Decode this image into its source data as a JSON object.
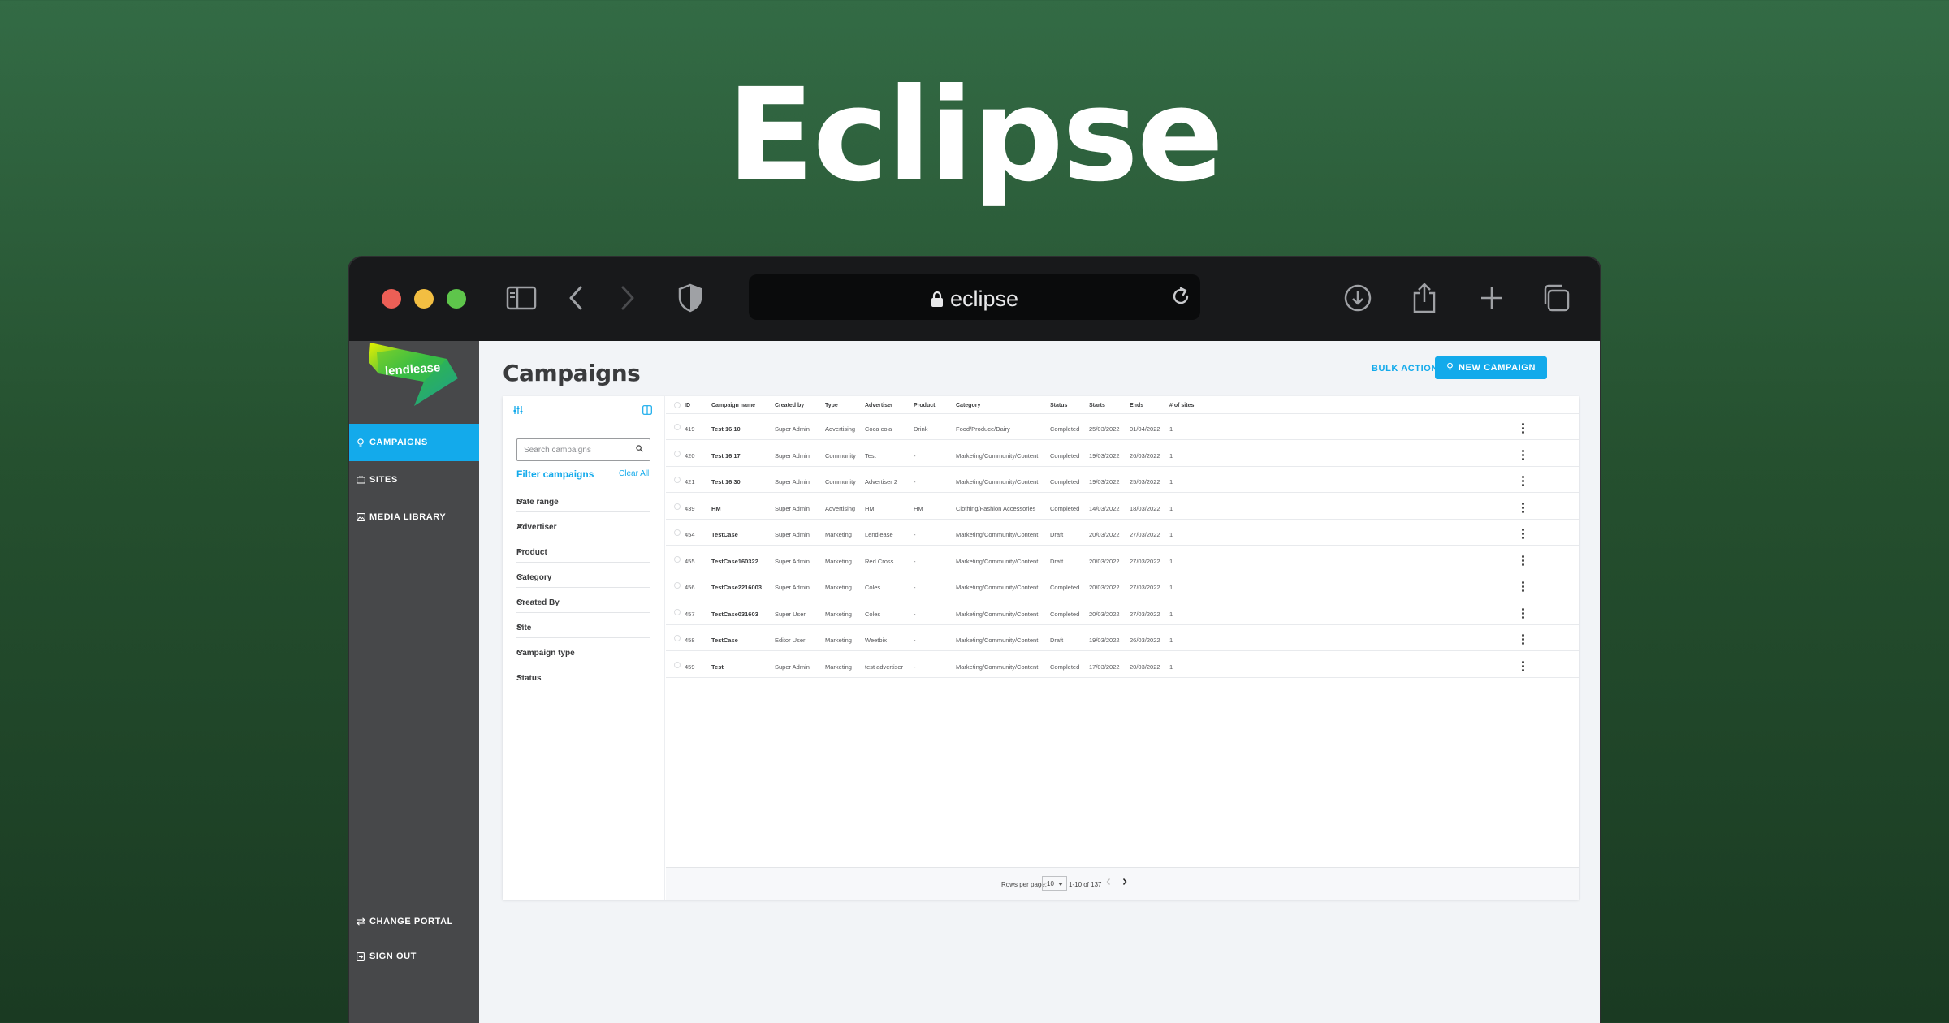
{
  "hero": {
    "title": "Eclipse"
  },
  "browser": {
    "url": "eclipse"
  },
  "sidebar": {
    "logo_text": "lendlease",
    "items": [
      {
        "label": "CAMPAIGNS",
        "icon": "lightbulb-icon",
        "active": true
      },
      {
        "label": "SITES",
        "icon": "tv-icon",
        "active": false
      },
      {
        "label": "MEDIA LIBRARY",
        "icon": "image-icon",
        "active": false
      }
    ],
    "bottom_items": [
      {
        "label": "CHANGE PORTAL",
        "icon": "swap-icon"
      },
      {
        "label": "SIGN OUT",
        "icon": "signout-icon"
      }
    ]
  },
  "page": {
    "title": "Campaigns",
    "bulk_actions": "BULK ACTIONS",
    "new_campaign": "NEW CAMPAIGN"
  },
  "filters": {
    "search_placeholder": "Search campaigns",
    "title": "Filter campaigns",
    "clear_all": "Clear All",
    "items": [
      "Date range",
      "Advertiser",
      "Product",
      "Category",
      "Created By",
      "Site",
      "Campaign type",
      "Status"
    ]
  },
  "table": {
    "columns": [
      "ID",
      "Campaign name",
      "Created by",
      "Type",
      "Advertiser",
      "Product",
      "Category",
      "Status",
      "Starts",
      "Ends",
      "# of sites"
    ],
    "rows": [
      [
        "419",
        "Test 16 10",
        "Super Admin",
        "Advertising",
        "Coca cola",
        "Drink",
        "Food/Produce/Dairy",
        "Completed",
        "25/03/2022",
        "01/04/2022",
        "1"
      ],
      [
        "420",
        "Test 16 17",
        "Super Admin",
        "Community",
        "Test",
        "-",
        "Marketing/Community/Content",
        "Completed",
        "19/03/2022",
        "26/03/2022",
        "1"
      ],
      [
        "421",
        "Test 16 30",
        "Super Admin",
        "Community",
        "Advertiser 2",
        "-",
        "Marketing/Community/Content",
        "Completed",
        "19/03/2022",
        "25/03/2022",
        "1"
      ],
      [
        "439",
        "HM",
        "Super Admin",
        "Advertising",
        "HM",
        "HM",
        "Clothing/Fashion Accessories",
        "Completed",
        "14/03/2022",
        "18/03/2022",
        "1"
      ],
      [
        "454",
        "TestCase",
        "Super Admin",
        "Marketing",
        "Lendlease",
        "-",
        "Marketing/Community/Content",
        "Draft",
        "20/03/2022",
        "27/03/2022",
        "1"
      ],
      [
        "455",
        "TestCase160322",
        "Super Admin",
        "Marketing",
        "Red Cross",
        "-",
        "Marketing/Community/Content",
        "Draft",
        "20/03/2022",
        "27/03/2022",
        "1"
      ],
      [
        "456",
        "TestCase2216003",
        "Super Admin",
        "Marketing",
        "Coles",
        "-",
        "Marketing/Community/Content",
        "Completed",
        "20/03/2022",
        "27/03/2022",
        "1"
      ],
      [
        "457",
        "TestCase031603",
        "Super User",
        "Marketing",
        "Coles",
        "-",
        "Marketing/Community/Content",
        "Completed",
        "20/03/2022",
        "27/03/2022",
        "1"
      ],
      [
        "458",
        "TestCase",
        "Editor User",
        "Marketing",
        "Weetbix",
        "-",
        "Marketing/Community/Content",
        "Draft",
        "19/03/2022",
        "26/03/2022",
        "1"
      ],
      [
        "459",
        "Test",
        "Super Admin",
        "Marketing",
        "test advertiser",
        "-",
        "Marketing/Community/Content",
        "Completed",
        "17/03/2022",
        "20/03/2022",
        "1"
      ]
    ]
  },
  "pagination": {
    "rows_per_page_label": "Rows per page:",
    "rows_per_page": "10",
    "range": "1-10 of 137"
  },
  "colors": {
    "accent": "#13aaeb",
    "sidebar": "#47484a",
    "background_top": "#336b45"
  }
}
